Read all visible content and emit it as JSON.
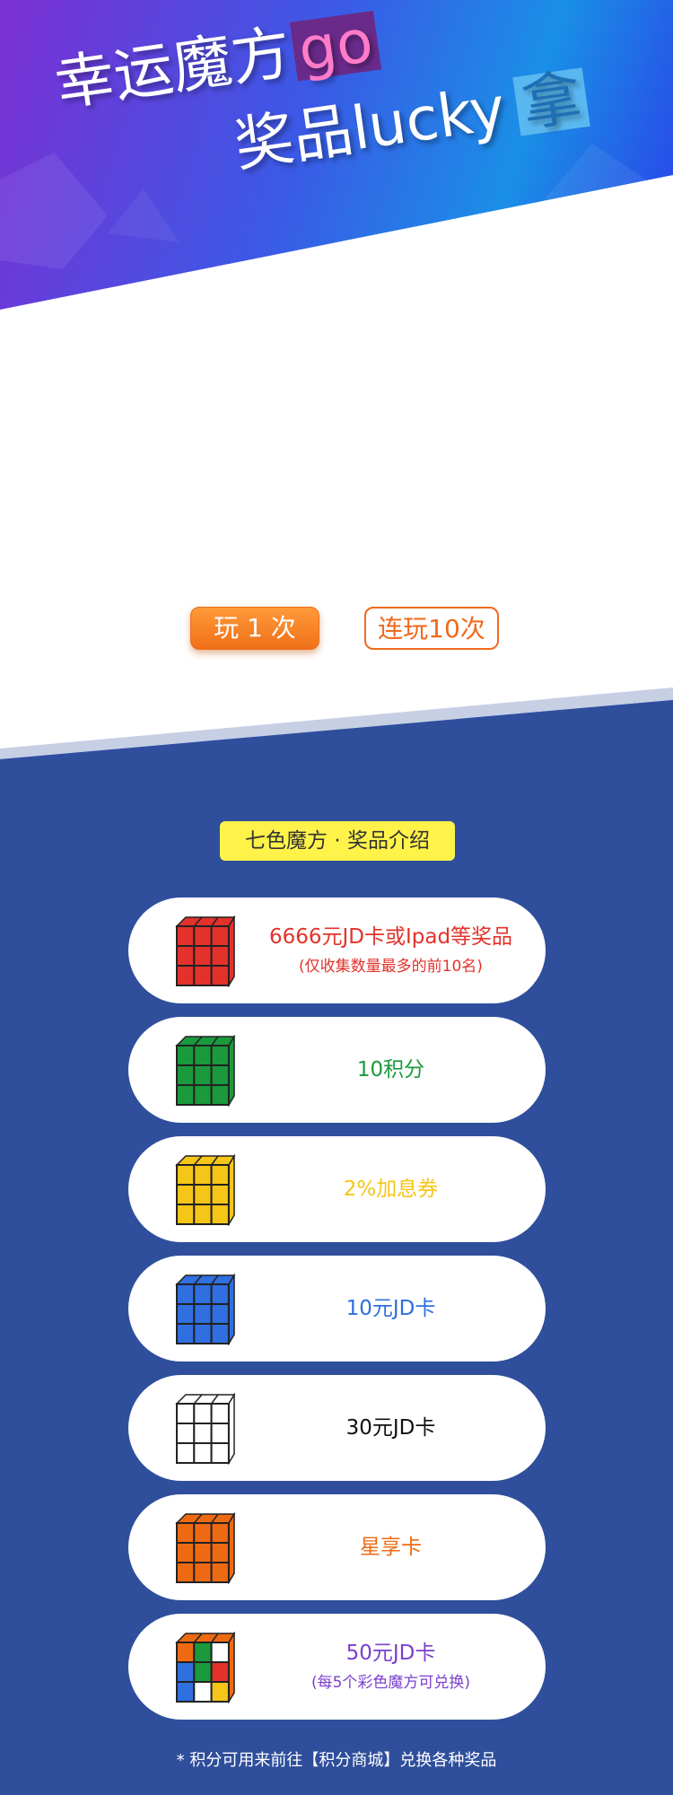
{
  "banner": {
    "title_line1": "幸运魔方",
    "title_line1_highlight": "go",
    "title_line2": "奖品lucky",
    "title_line2_highlight": "拿"
  },
  "actions": {
    "play_once": "玩 1 次",
    "play_ten": "连玩10次"
  },
  "prizes_section": {
    "title": "七色魔方 · 奖品介绍",
    "items": [
      {
        "title": "6666元JD卡或Ipad等奖品",
        "subtitle": "(仅收集数量最多的前10名)",
        "color": "#e3322b"
      },
      {
        "title": "10积分",
        "subtitle": "",
        "color": "#1a9a3c"
      },
      {
        "title": "2%加息券",
        "subtitle": "",
        "color": "#f5c518"
      },
      {
        "title": "10元JD卡",
        "subtitle": "",
        "color": "#2f6fe0"
      },
      {
        "title": "30元JD卡",
        "subtitle": "",
        "color": "#111111"
      },
      {
        "title": "星享卡",
        "subtitle": "",
        "color": "#ee6a12"
      },
      {
        "title": "50元JD卡",
        "subtitle": "(每5个彩色魔方可兑换)",
        "color": "#7b3fd0"
      }
    ],
    "cube_face_colors": [
      [
        "#e3322b",
        "#e3322b",
        "#e3322b",
        "#e3322b",
        "#e3322b",
        "#e3322b",
        "#e3322b",
        "#e3322b",
        "#e3322b"
      ],
      [
        "#1a9a3c",
        "#1a9a3c",
        "#1a9a3c",
        "#1a9a3c",
        "#1a9a3c",
        "#1a9a3c",
        "#1a9a3c",
        "#1a9a3c",
        "#1a9a3c"
      ],
      [
        "#f5c518",
        "#f5c518",
        "#f5c518",
        "#f5c518",
        "#f5c518",
        "#f5c518",
        "#f5c518",
        "#f5c518",
        "#f5c518"
      ],
      [
        "#2f6fe0",
        "#2f6fe0",
        "#2f6fe0",
        "#2f6fe0",
        "#2f6fe0",
        "#2f6fe0",
        "#2f6fe0",
        "#2f6fe0",
        "#2f6fe0"
      ],
      [
        "#ffffff",
        "#ffffff",
        "#ffffff",
        "#ffffff",
        "#ffffff",
        "#ffffff",
        "#ffffff",
        "#ffffff",
        "#ffffff"
      ],
      [
        "#ee6a12",
        "#ee6a12",
        "#ee6a12",
        "#ee6a12",
        "#ee6a12",
        "#ee6a12",
        "#ee6a12",
        "#ee6a12",
        "#ee6a12"
      ],
      [
        "#ee6a12",
        "#1a9a3c",
        "#ffffff",
        "#2f6fe0",
        "#1a9a3c",
        "#e3322b",
        "#2f6fe0",
        "#ffffff",
        "#f5c518"
      ]
    ]
  },
  "footer": {
    "note": "* 积分可用来前往【积分商城】兑换各种奖品"
  }
}
